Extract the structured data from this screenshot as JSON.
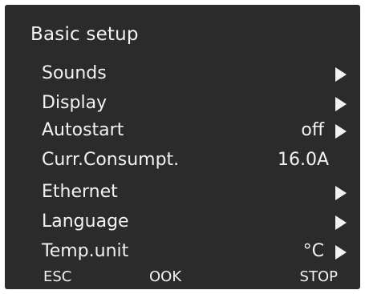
{
  "screen": {
    "title": "Basic setup"
  },
  "menu": {
    "items": [
      {
        "label": "Sounds",
        "value": ""
      },
      {
        "label": "Display",
        "value": ""
      },
      {
        "label": "Autostart",
        "value": "off"
      },
      {
        "label": "Curr.Consumpt.",
        "value": "16.0A"
      },
      {
        "label": "Ethernet",
        "value": ""
      },
      {
        "label": "Language",
        "value": ""
      },
      {
        "label": "Temp.unit",
        "value": "°C"
      }
    ]
  },
  "footer": {
    "esc": "ESC",
    "ok": "OOK",
    "stop": "STOP"
  }
}
